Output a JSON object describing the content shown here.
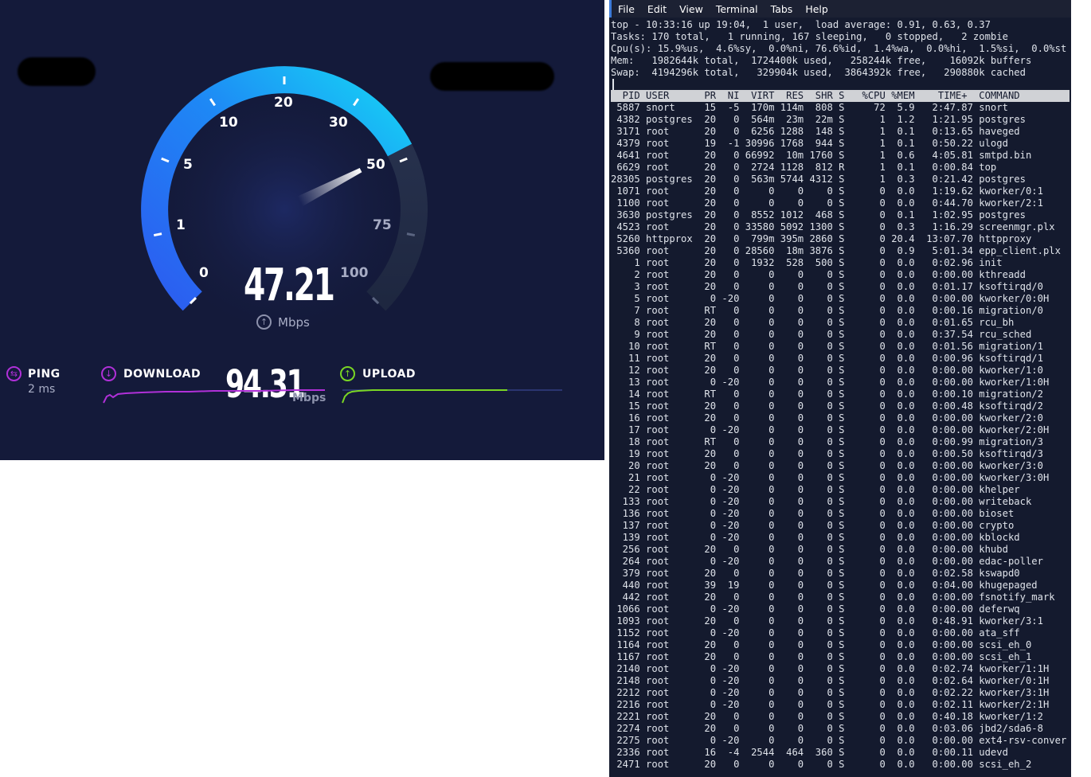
{
  "speedtest": {
    "gauge_labels": [
      "0",
      "1",
      "5",
      "10",
      "20",
      "30",
      "50",
      "75",
      "100"
    ],
    "speed_value": "47.21",
    "speed_unit": "Mbps",
    "speed_needle_value": 47.21,
    "ping": {
      "label": "PING",
      "value": "2 ms"
    },
    "download": {
      "label": "DOWNLOAD",
      "value": "94.31",
      "unit": "Mbps"
    },
    "upload": {
      "label": "UPLOAD"
    },
    "colors": {
      "background": "#141a3a",
      "gauge_start": "#2c5cf0",
      "gauge_end": "#16d3f5",
      "ping": "#b030d8",
      "download": "#b030d8",
      "upload": "#7ad624"
    }
  },
  "terminal": {
    "menu": [
      "File",
      "Edit",
      "View",
      "Terminal",
      "Tabs",
      "Help"
    ],
    "summary": [
      "top - 10:33:16 up 19:04,  1 user,  load average: 0.91, 0.63, 0.37",
      "Tasks: 170 total,   1 running, 167 sleeping,   0 stopped,   2 zombie",
      "Cpu(s): 15.9%us,  4.6%sy,  0.0%ni, 76.6%id,  1.4%wa,  0.0%hi,  1.5%si,  0.0%st",
      "Mem:   1982644k total,  1724400k used,   258244k free,    16092k buffers",
      "Swap:  4194296k total,   329904k used,  3864392k free,   290880k cached"
    ],
    "header": "  PID USER      PR  NI  VIRT  RES  SHR S   %CPU %MEM    TIME+  COMMAND",
    "processes": [
      " 5887 snort     15  -5  170m 114m  808 S     72  5.9   2:47.87 snort",
      " 4382 postgres  20   0  564m  23m  22m S      1  1.2   1:21.95 postgres",
      " 3171 root      20   0  6256 1288  148 S      1  0.1   0:13.65 haveged",
      " 4379 root      19  -1 30996 1768  944 S      1  0.1   0:50.22 ulogd",
      " 4641 root      20   0 66992  10m 1760 S      1  0.6   4:05.81 smtpd.bin",
      " 6629 root      20   0  2724 1128  812 R      1  0.1   0:00.84 top",
      "28305 postgres  20   0  563m 5744 4312 S      1  0.3   0:21.42 postgres",
      " 1071 root      20   0     0    0    0 S      0  0.0   1:19.62 kworker/0:1",
      " 1100 root      20   0     0    0    0 S      0  0.0   0:44.70 kworker/2:1",
      " 3630 postgres  20   0  8552 1012  468 S      0  0.1   1:02.95 postgres",
      " 4523 root      20   0 33580 5092 1300 S      0  0.3   1:16.29 screenmgr.plx",
      " 5260 httpprox  20   0  799m 395m 2860 S      0 20.4  13:07.70 httpproxy",
      " 5360 root      20   0 28560  18m 3876 S      0  0.9   5:01.34 epp_client.plx",
      "    1 root      20   0  1932  528  500 S      0  0.0   0:02.96 init",
      "    2 root      20   0     0    0    0 S      0  0.0   0:00.00 kthreadd",
      "    3 root      20   0     0    0    0 S      0  0.0   0:01.17 ksoftirqd/0",
      "    5 root       0 -20     0    0    0 S      0  0.0   0:00.00 kworker/0:0H",
      "    7 root      RT   0     0    0    0 S      0  0.0   0:00.16 migration/0",
      "    8 root      20   0     0    0    0 S      0  0.0   0:01.65 rcu_bh",
      "    9 root      20   0     0    0    0 S      0  0.0   0:37.54 rcu_sched",
      "   10 root      RT   0     0    0    0 S      0  0.0   0:01.56 migration/1",
      "   11 root      20   0     0    0    0 S      0  0.0   0:00.96 ksoftirqd/1",
      "   12 root      20   0     0    0    0 S      0  0.0   0:00.00 kworker/1:0",
      "   13 root       0 -20     0    0    0 S      0  0.0   0:00.00 kworker/1:0H",
      "   14 root      RT   0     0    0    0 S      0  0.0   0:00.10 migration/2",
      "   15 root      20   0     0    0    0 S      0  0.0   0:00.48 ksoftirqd/2",
      "   16 root      20   0     0    0    0 S      0  0.0   0:00.00 kworker/2:0",
      "   17 root       0 -20     0    0    0 S      0  0.0   0:00.00 kworker/2:0H",
      "   18 root      RT   0     0    0    0 S      0  0.0   0:00.99 migration/3",
      "   19 root      20   0     0    0    0 S      0  0.0   0:00.50 ksoftirqd/3",
      "   20 root      20   0     0    0    0 S      0  0.0   0:00.00 kworker/3:0",
      "   21 root       0 -20     0    0    0 S      0  0.0   0:00.00 kworker/3:0H",
      "   22 root       0 -20     0    0    0 S      0  0.0   0:00.00 khelper",
      "  133 root       0 -20     0    0    0 S      0  0.0   0:00.00 writeback",
      "  136 root       0 -20     0    0    0 S      0  0.0   0:00.00 bioset",
      "  137 root       0 -20     0    0    0 S      0  0.0   0:00.00 crypto",
      "  139 root       0 -20     0    0    0 S      0  0.0   0:00.00 kblockd",
      "  256 root      20   0     0    0    0 S      0  0.0   0:00.00 khubd",
      "  264 root       0 -20     0    0    0 S      0  0.0   0:00.00 edac-poller",
      "  379 root      20   0     0    0    0 S      0  0.0   0:02.58 kswapd0",
      "  440 root      39  19     0    0    0 S      0  0.0   0:04.00 khugepaged",
      "  442 root      20   0     0    0    0 S      0  0.0   0:00.00 fsnotify_mark",
      " 1066 root       0 -20     0    0    0 S      0  0.0   0:00.00 deferwq",
      " 1093 root      20   0     0    0    0 S      0  0.0   0:48.91 kworker/3:1",
      " 1152 root       0 -20     0    0    0 S      0  0.0   0:00.00 ata_sff",
      " 1164 root      20   0     0    0    0 S      0  0.0   0:00.00 scsi_eh_0",
      " 1167 root      20   0     0    0    0 S      0  0.0   0:00.00 scsi_eh_1",
      " 2140 root       0 -20     0    0    0 S      0  0.0   0:02.74 kworker/1:1H",
      " 2148 root       0 -20     0    0    0 S      0  0.0   0:02.64 kworker/0:1H",
      " 2212 root       0 -20     0    0    0 S      0  0.0   0:02.22 kworker/3:1H",
      " 2216 root       0 -20     0    0    0 S      0  0.0   0:02.11 kworker/2:1H",
      " 2221 root      20   0     0    0    0 S      0  0.0   0:40.18 kworker/1:2",
      " 2274 root      20   0     0    0    0 S      0  0.0   0:03.06 jbd2/sda6-8",
      " 2275 root       0 -20     0    0    0 S      0  0.0   0:00.00 ext4-rsv-conver",
      " 2336 root      16  -4  2544  464  360 S      0  0.0   0:00.11 udevd",
      " 2471 root      20   0     0    0    0 S      0  0.0   0:00.00 scsi_eh_2"
    ]
  }
}
